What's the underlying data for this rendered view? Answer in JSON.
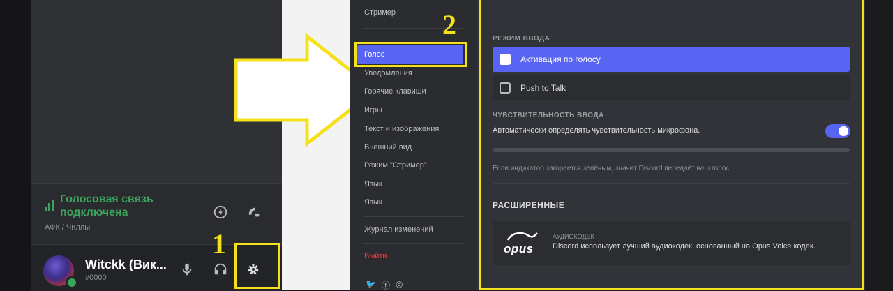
{
  "annotations": {
    "step1": "1",
    "step2": "2",
    "highlight_color": "#f4e11b"
  },
  "left_panel": {
    "voice_status": "Голосовая связь подключена",
    "voice_channel": "АФК / Чиллы",
    "user": {
      "name": "Witckk (Вик...",
      "tag": "#0000"
    },
    "icons": {
      "noise": "waveform-icon",
      "disconnect": "phone-disconnect-icon",
      "mic": "microphone-icon",
      "headphones": "headphones-icon",
      "settings": "gear-icon"
    }
  },
  "settings_nav": {
    "items": [
      {
        "label": "Стример",
        "highlight": false
      },
      {
        "label": "Голос",
        "highlight": true
      },
      {
        "label": "Уведомления",
        "highlight": false
      },
      {
        "label": "Горячие клавиши",
        "highlight": false
      },
      {
        "label": "Игры",
        "highlight": false
      },
      {
        "label": "Текст и изображения",
        "highlight": false
      },
      {
        "label": "Внешний вид",
        "highlight": false
      },
      {
        "label": "Режим \"Стример\"",
        "highlight": false
      },
      {
        "label": "Язык",
        "highlight": false
      },
      {
        "label": "Журнал изменений",
        "highlight": false
      },
      {
        "label": "Выйти",
        "highlight": false
      }
    ],
    "social_icons": [
      "twitter-icon",
      "facebook-icon",
      "instagram-icon"
    ]
  },
  "voice_settings": {
    "input_mode_label": "Режим ввода",
    "modes": [
      {
        "label": "Активация по голосу",
        "selected": true
      },
      {
        "label": "Push to Talk",
        "selected": false
      }
    ],
    "sensitivity_label": "Чувствительность ввода",
    "auto_sensitivity_text": "Автоматически определять чувствительность микрофона.",
    "auto_sensitivity_on": true,
    "hint_text": "Если индикатор загорается зелёным, значит Discord передаёт ваш голос.",
    "advanced_label": "Расширенные",
    "codec": {
      "logo_text": "opus",
      "title": "Аудиокодек",
      "description": "Discord использует лучший аудиокодек, основанный на Opus Voice кодек."
    }
  },
  "colors": {
    "accent": "#5865f2",
    "online": "#3ba55d",
    "logout": "#ed4245"
  }
}
